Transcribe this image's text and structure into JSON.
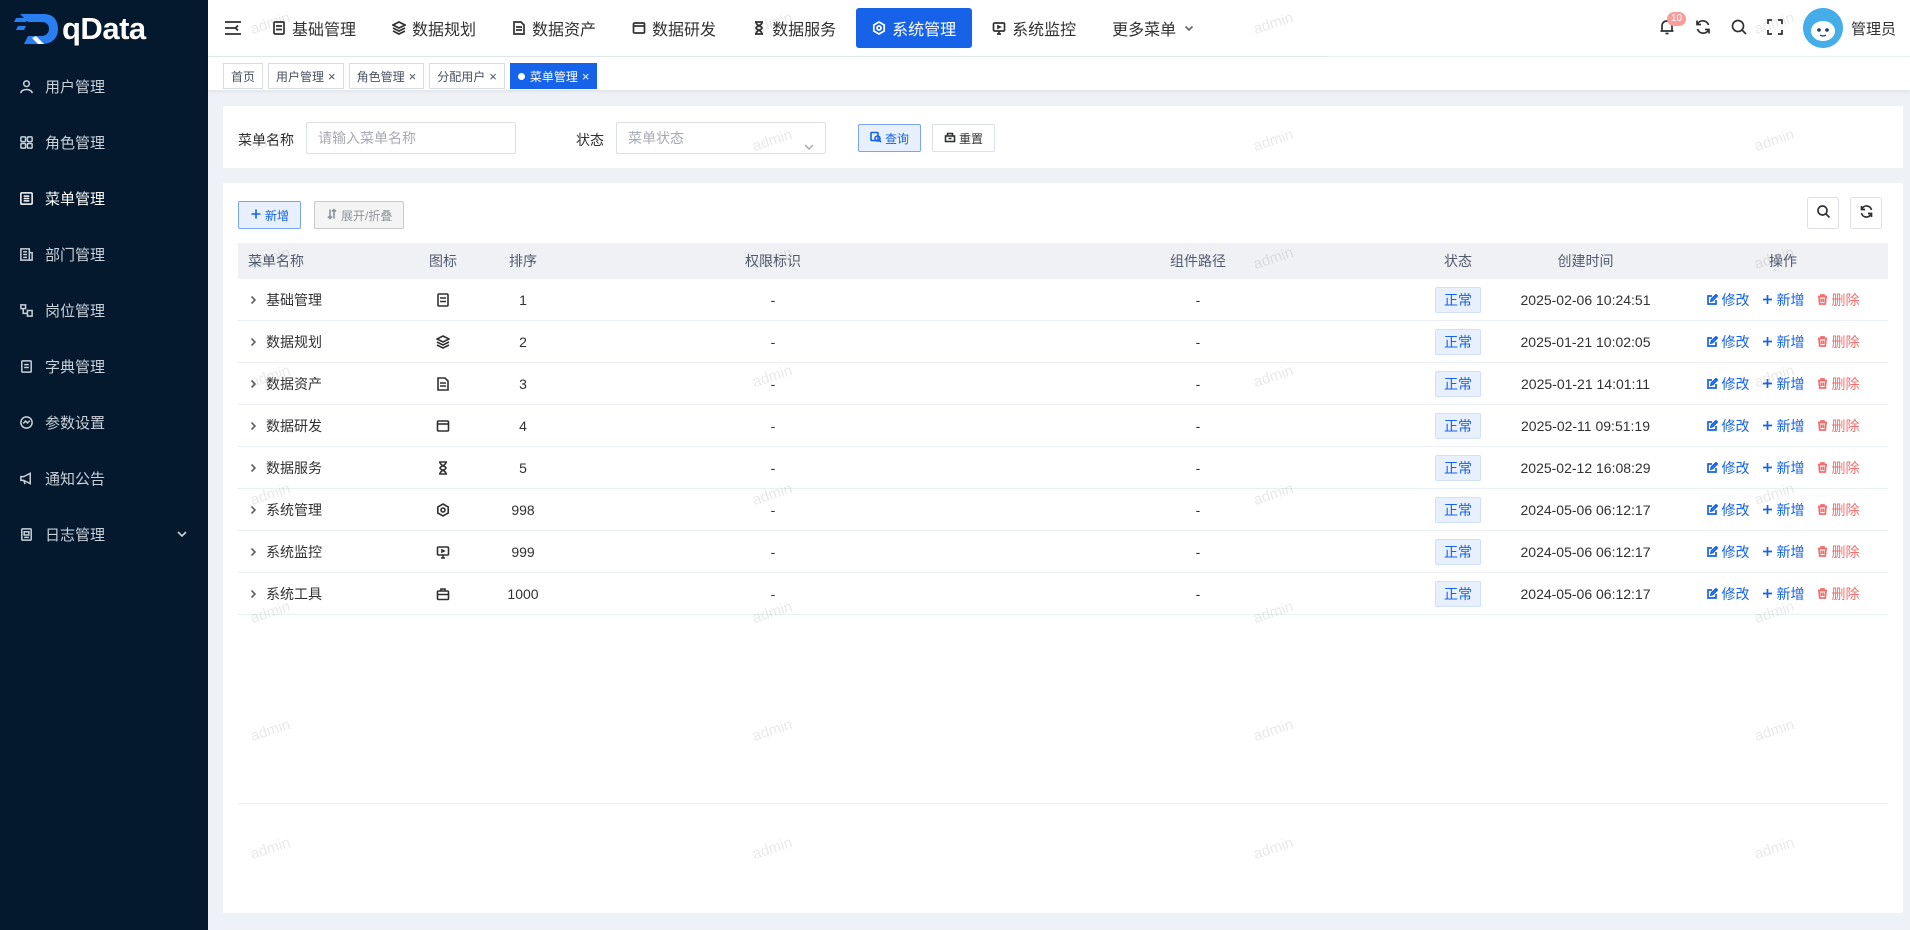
{
  "brand": {
    "name": "qData"
  },
  "sidebar": {
    "items": [
      {
        "label": "用户管理",
        "icon": "user-icon"
      },
      {
        "label": "角色管理",
        "icon": "grid-icon"
      },
      {
        "label": "菜单管理",
        "icon": "list-icon",
        "active": true
      },
      {
        "label": "部门管理",
        "icon": "building-icon"
      },
      {
        "label": "岗位管理",
        "icon": "post-icon"
      },
      {
        "label": "字典管理",
        "icon": "book-icon"
      },
      {
        "label": "参数设置",
        "icon": "settings-icon"
      },
      {
        "label": "通知公告",
        "icon": "megaphone-icon"
      },
      {
        "label": "日志管理",
        "icon": "log-icon",
        "has_children": true
      }
    ]
  },
  "topnav": {
    "items": [
      {
        "label": "基础管理"
      },
      {
        "label": "数据规划"
      },
      {
        "label": "数据资产"
      },
      {
        "label": "数据研发"
      },
      {
        "label": "数据服务"
      },
      {
        "label": "系统管理",
        "active": true
      },
      {
        "label": "系统监控"
      },
      {
        "label": "更多菜单"
      }
    ]
  },
  "header": {
    "notify_count": "10",
    "username": "管理员"
  },
  "tags": [
    {
      "label": "首页"
    },
    {
      "label": "用户管理"
    },
    {
      "label": "角色管理"
    },
    {
      "label": "分配用户"
    },
    {
      "label": "菜单管理",
      "active": true
    }
  ],
  "search": {
    "menu_name_label": "菜单名称",
    "menu_name_placeholder": "请输入菜单名称",
    "status_label": "状态",
    "status_placeholder": "菜单状态",
    "query_btn": "查询",
    "reset_btn": "重置"
  },
  "toolbar": {
    "add_btn": "新增",
    "expand_btn": "展开/折叠"
  },
  "table": {
    "columns": {
      "name": "菜单名称",
      "icon": "图标",
      "order": "排序",
      "perm": "权限标识",
      "path": "组件路径",
      "status": "状态",
      "created": "创建时间",
      "ops": "操作"
    },
    "ops": {
      "edit": "修改",
      "add": "新增",
      "delete": "删除"
    },
    "rows": [
      {
        "name": "基础管理",
        "icon": "server-icon",
        "order": "1",
        "perm": "-",
        "path": "-",
        "status": "正常",
        "created": "2025-02-06 10:24:51"
      },
      {
        "name": "数据规划",
        "icon": "layers-icon",
        "order": "2",
        "perm": "-",
        "path": "-",
        "status": "正常",
        "created": "2025-01-21 10:02:05"
      },
      {
        "name": "数据资产",
        "icon": "document-icon",
        "order": "3",
        "perm": "-",
        "path": "-",
        "status": "正常",
        "created": "2025-01-21 14:01:11"
      },
      {
        "name": "数据研发",
        "icon": "window-icon",
        "order": "4",
        "perm": "-",
        "path": "-",
        "status": "正常",
        "created": "2025-02-11 09:51:19"
      },
      {
        "name": "数据服务",
        "icon": "hourglass-icon",
        "order": "5",
        "perm": "-",
        "path": "-",
        "status": "正常",
        "created": "2025-02-12 16:08:29"
      },
      {
        "name": "系统管理",
        "icon": "hexagon-gear-icon",
        "order": "998",
        "perm": "-",
        "path": "-",
        "status": "正常",
        "created": "2024-05-06 06:12:17"
      },
      {
        "name": "系统监控",
        "icon": "monitor-icon",
        "order": "999",
        "perm": "-",
        "path": "-",
        "status": "正常",
        "created": "2024-05-06 06:12:17"
      },
      {
        "name": "系统工具",
        "icon": "toolbox-icon",
        "order": "1000",
        "perm": "-",
        "path": "-",
        "status": "正常",
        "created": "2024-05-06 06:12:17"
      }
    ]
  },
  "watermark": "admin",
  "colors": {
    "primary": "#1662e8",
    "sidebar_bg": "#04192d",
    "danger": "#f56c6c"
  }
}
